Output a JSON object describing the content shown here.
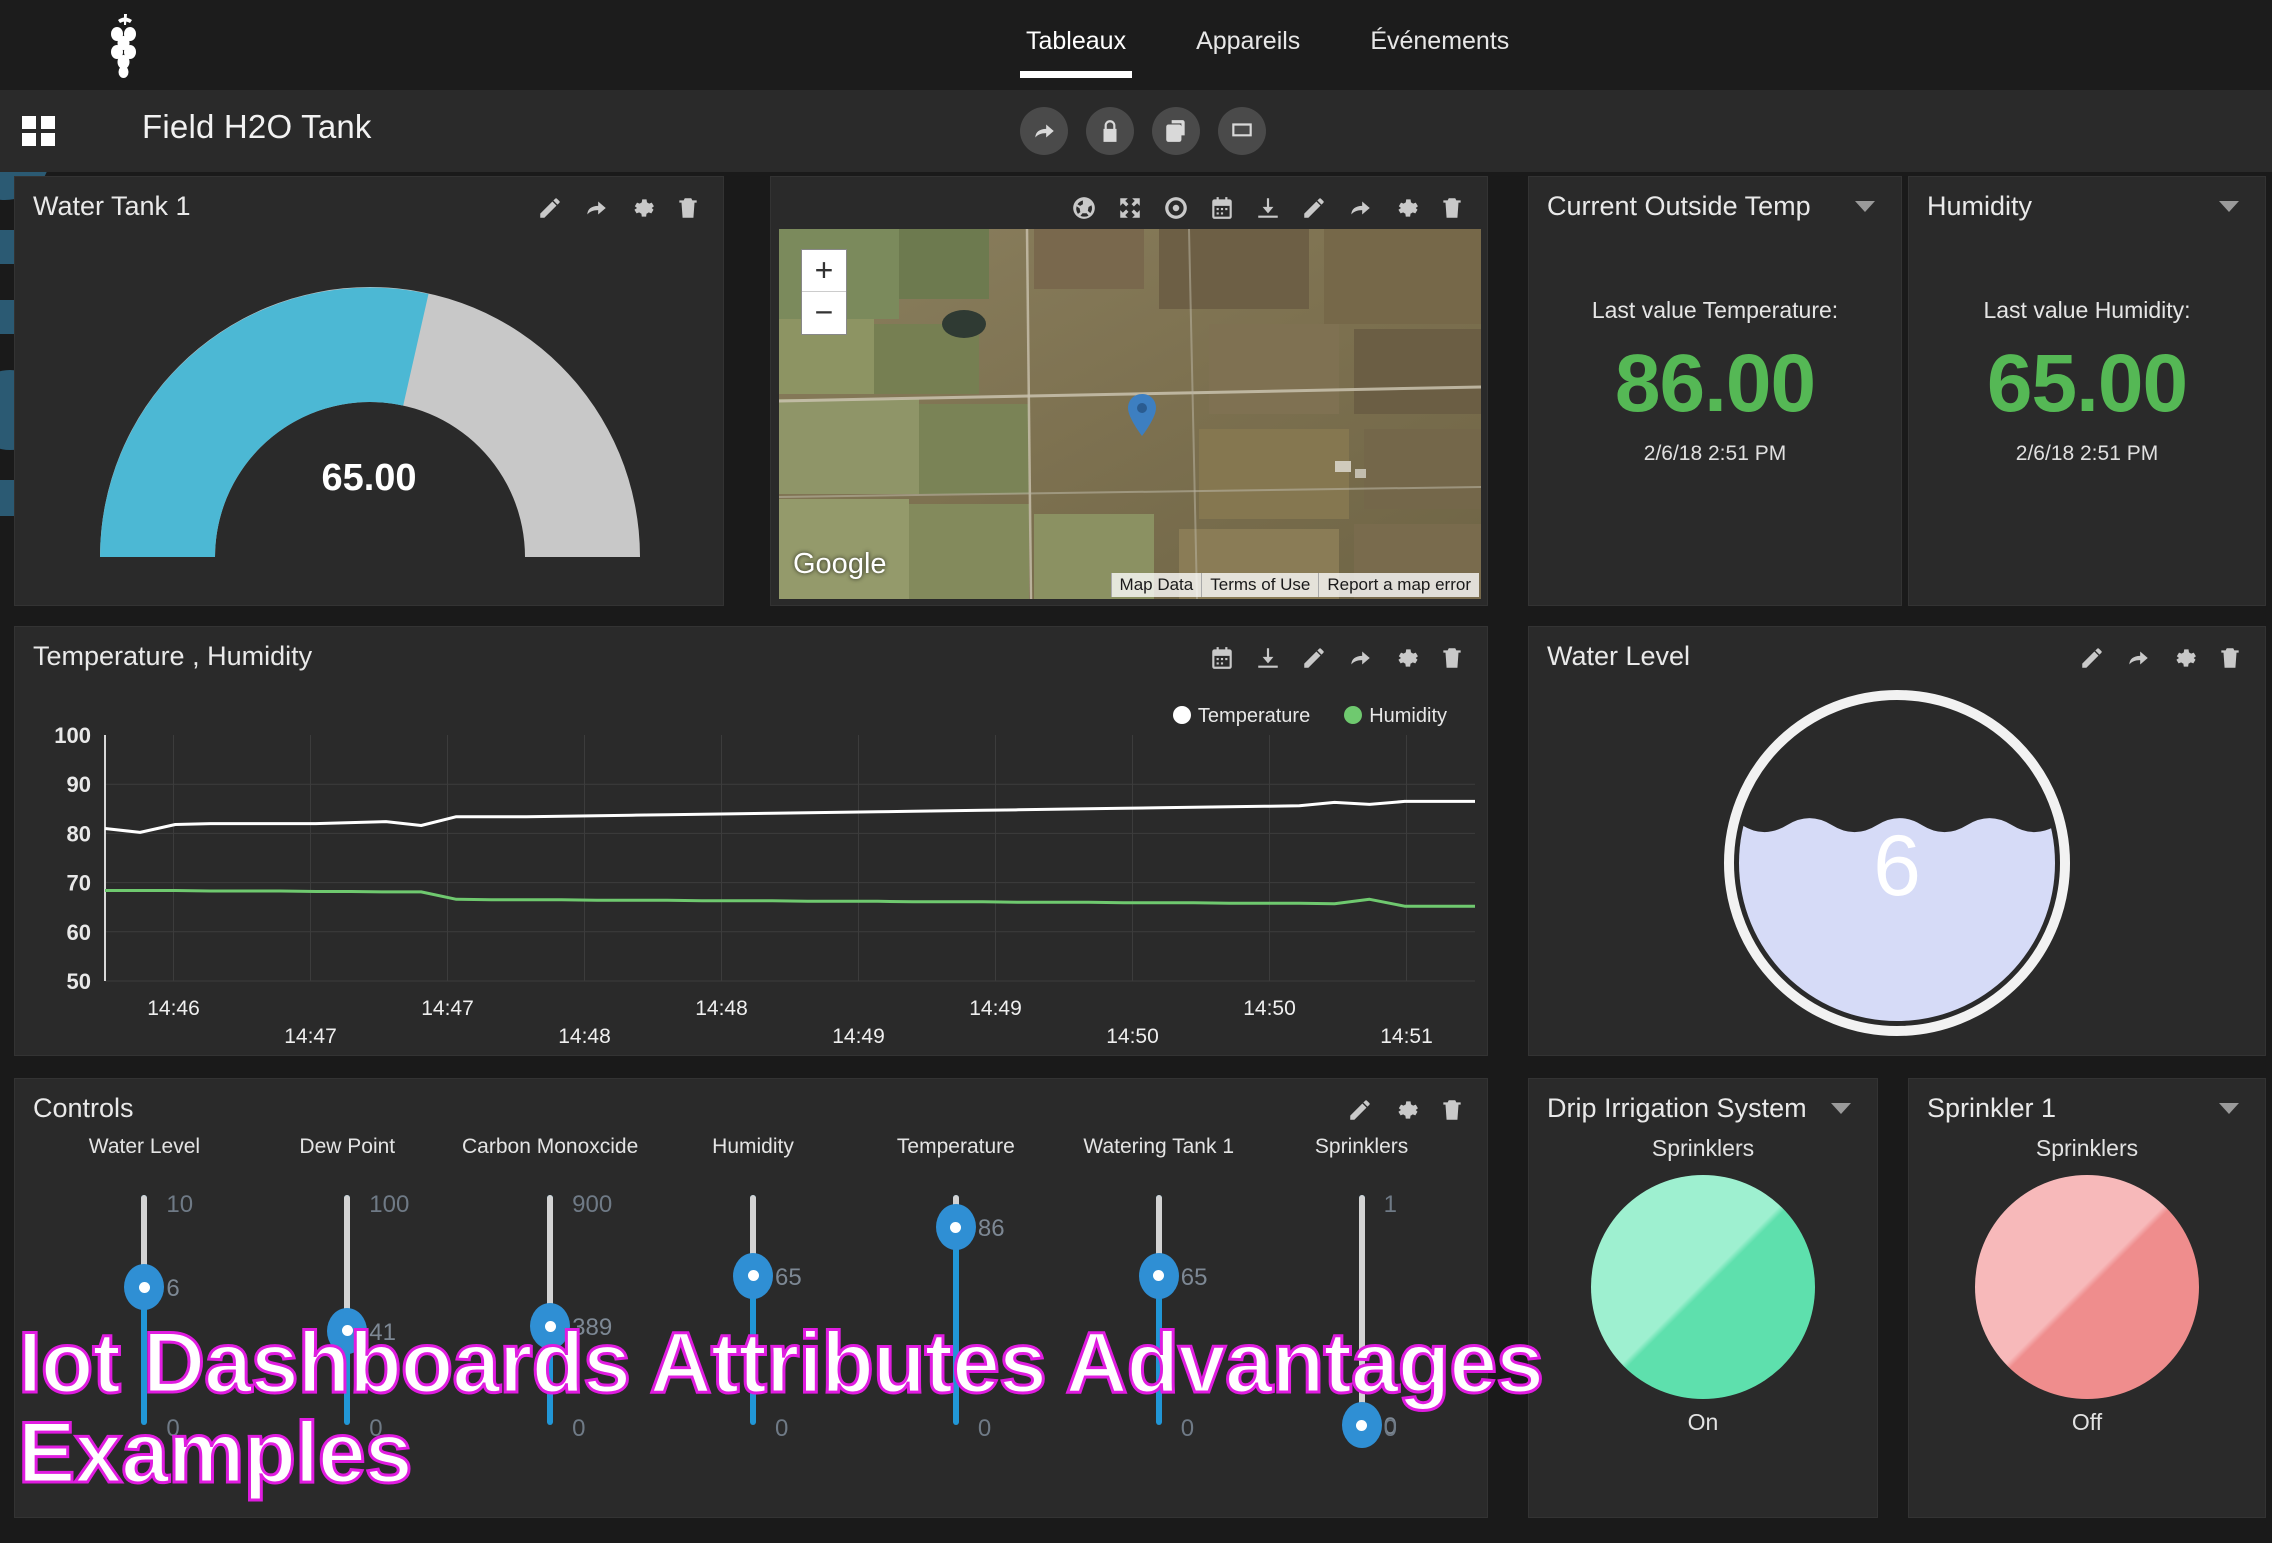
{
  "nav": {
    "logo_icon": "grapes-logo-icon",
    "links": [
      {
        "label": "Tableaux",
        "active": true
      },
      {
        "label": "Appareils",
        "active": false
      },
      {
        "label": "Événements",
        "active": false
      }
    ]
  },
  "header": {
    "grid_icon": "grid-menu-icon",
    "title": "Field H2O Tank",
    "actions": [
      {
        "icon": "share-icon"
      },
      {
        "icon": "lock-icon"
      },
      {
        "icon": "copy-icon"
      },
      {
        "icon": "fullscreen-icon"
      }
    ]
  },
  "panels": {
    "water_tank": {
      "title": "Water Tank 1",
      "value": "65.00",
      "min": "0",
      "max": "100",
      "percent": 65,
      "arc_color": "#4cb8d4",
      "track_color": "#c8c8c8",
      "icons": [
        "pencil-icon",
        "share-icon",
        "gear-icon",
        "trash-icon"
      ]
    },
    "map": {
      "zoom_in": "+",
      "zoom_out": "−",
      "watermark": "Google",
      "attribution": [
        "Map Data",
        "Terms of Use",
        "Report a map error"
      ],
      "icons": [
        "globe-icon",
        "expand-icon",
        "locate-icon",
        "calendar-icon",
        "download-icon",
        "pencil-icon",
        "share-icon",
        "gear-icon",
        "trash-icon"
      ]
    },
    "current_outside_temp": {
      "title": "Current Outside Temp",
      "label": "Last value Temperature:",
      "value": "86.00",
      "timestamp": "2/6/18 2:51 PM",
      "value_color": "#55b855"
    },
    "humidity": {
      "title": "Humidity",
      "label": "Last value Humidity:",
      "value": "65.00",
      "timestamp": "2/6/18 2:51 PM",
      "value_color": "#55b855"
    },
    "chart": {
      "title": "Temperature , Humidity",
      "icons": [
        "calendar-icon",
        "download-icon",
        "pencil-icon",
        "share-icon",
        "gear-icon",
        "trash-icon"
      ]
    },
    "water_level": {
      "title": "Water Level",
      "value": "6",
      "fill_percent": 62,
      "fill_color": "#d6dbf7",
      "ring_color": "#f2f2f2",
      "icons": [
        "pencil-icon",
        "share-icon",
        "gear-icon",
        "trash-icon"
      ]
    },
    "controls": {
      "title": "Controls",
      "icons": [
        "pencil-icon",
        "gear-icon",
        "trash-icon"
      ],
      "sliders": [
        {
          "label": "Water Level",
          "value": "6",
          "max": "10",
          "min": "0",
          "percent": 60
        },
        {
          "label": "Dew Point",
          "value": "41",
          "max": "100",
          "min": "0",
          "percent": 41
        },
        {
          "label": "Carbon Monoxcide",
          "value": "389",
          "max": "900",
          "min": "0",
          "percent": 43
        },
        {
          "label": "Humidity",
          "value": "65",
          "max": "",
          "min": "0",
          "percent": 65
        },
        {
          "label": "Temperature",
          "value": "86",
          "max": "",
          "min": "0",
          "percent": 86
        },
        {
          "label": "Watering Tank 1",
          "value": "65",
          "max": "",
          "min": "0",
          "percent": 65
        },
        {
          "label": "Sprinklers",
          "value": "0",
          "max": "1",
          "min": "0",
          "percent": 0
        }
      ]
    },
    "drip_irrigation": {
      "title": "Drip Irrigation System",
      "subtitle": "Sprinklers",
      "state": "On",
      "color": "#6ee7b7"
    },
    "sprinkler_1": {
      "title": "Sprinkler 1",
      "subtitle": "Sprinklers",
      "state": "Off",
      "color": "#f2a0a0"
    }
  },
  "watermark": {
    "text": "Iot Dashboards Attributes Advantages\nExamples"
  },
  "chart_data": {
    "type": "line",
    "title": "Temperature , Humidity",
    "xlabel": "",
    "ylabel": "",
    "ylim": [
      50,
      100
    ],
    "yticks": [
      50,
      60,
      70,
      80,
      90,
      100
    ],
    "grid": true,
    "legend_position": "top-right",
    "x_tick_labels": [
      "14:46",
      "14:47",
      "14:47",
      "14:48",
      "14:48",
      "14:49",
      "14:49",
      "14:50",
      "14:50",
      "14:51"
    ],
    "series": [
      {
        "name": "Temperature",
        "color": "#ffffff",
        "values": [
          81,
          80.2,
          81.8,
          82,
          82,
          82,
          82,
          82.2,
          82.4,
          81.6,
          83.4,
          83.4,
          83.4,
          83.5,
          83.6,
          83.7,
          83.8,
          83.9,
          84.0,
          84.1,
          84.2,
          84.3,
          84.4,
          84.5,
          84.6,
          84.7,
          84.8,
          84.9,
          85.0,
          85.1,
          85.2,
          85.3,
          85.4,
          85.5,
          85.6,
          86.3,
          85.9,
          86.5,
          86.5,
          86.5
        ]
      },
      {
        "name": "Humidity",
        "color": "#6fc96f",
        "values": [
          68.4,
          68.4,
          68.4,
          68.3,
          68.3,
          68.3,
          68.2,
          68.2,
          68.1,
          68.1,
          66.6,
          66.5,
          66.5,
          66.5,
          66.4,
          66.4,
          66.4,
          66.3,
          66.3,
          66.3,
          66.2,
          66.2,
          66.2,
          66.1,
          66.1,
          66.1,
          66.0,
          66.0,
          66.0,
          65.9,
          65.9,
          65.9,
          65.8,
          65.8,
          65.8,
          65.7,
          66.6,
          65.2,
          65.2,
          65.2
        ]
      }
    ]
  }
}
